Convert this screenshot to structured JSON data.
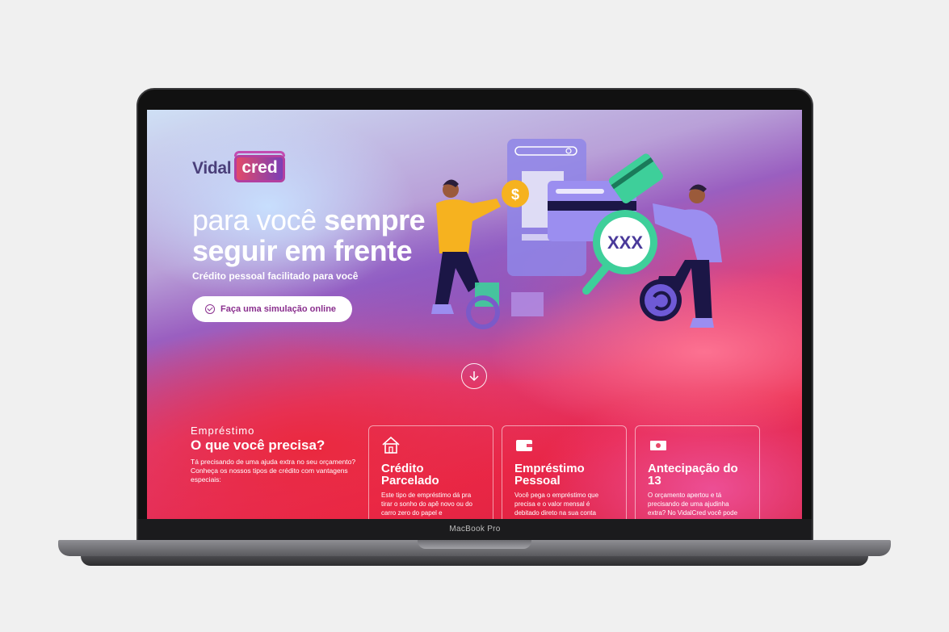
{
  "device": {
    "label": "MacBook Pro"
  },
  "brand": {
    "part1": "Vidal",
    "part2": "cred"
  },
  "hero": {
    "title_light": "para você ",
    "title_bold1": "sempre",
    "title_bold2": "seguir em frente",
    "subtitle": "Crédito pessoal facilitado para você",
    "cta_label": "Faça uma simulação online",
    "search_badge": "XXX"
  },
  "section": {
    "eyebrow": "Empréstimo",
    "title": "O que você precisa?",
    "description": "Tá precisando de uma ajuda extra no seu orçamento? Conheça os nossos tipos de crédito com vantagens especiais:"
  },
  "cards": [
    {
      "icon": "house-icon",
      "title": "Crédito Parcelado",
      "text": "Este tipo de empréstimo dá pra tirar o sonho do apê novo ou do carro zero do papel e"
    },
    {
      "icon": "wallet-icon",
      "title": "Empréstimo Pessoal",
      "text": "Você pega o empréstimo que precisa e o valor mensal é debitado direto na sua conta corrente."
    },
    {
      "icon": "cash-icon",
      "title": "Antecipação do 13",
      "text": "O orçamento apertou e tá precisando de uma ajudinha extra? No VidalCred você pode"
    }
  ],
  "colors": {
    "accent": "#8a2f8e",
    "brand_dark": "#4a3f7a",
    "illustration_purple": "#9b8ef0",
    "illustration_yellow": "#f6b21f",
    "illustration_green": "#3ecf9a"
  }
}
